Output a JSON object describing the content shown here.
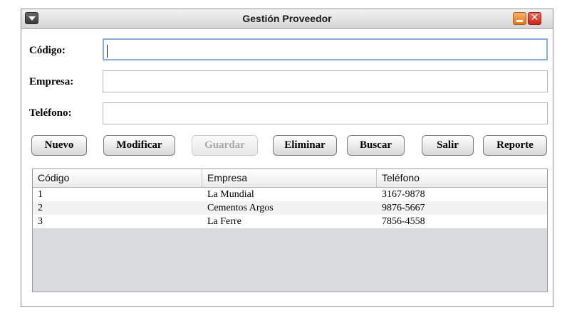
{
  "window": {
    "title": "Gestión Proveedor",
    "close_glyph": "✕"
  },
  "form": {
    "codigo_label": "Código:",
    "codigo_value": "",
    "empresa_label": "Empresa:",
    "empresa_value": "",
    "telefono_label": "Teléfono:",
    "telefono_value": ""
  },
  "buttons": {
    "nuevo": "Nuevo",
    "modificar": "Modificar",
    "guardar": "Guardar",
    "eliminar": "Eliminar",
    "buscar": "Buscar",
    "salir": "Salir",
    "reporte": "Reporte"
  },
  "table": {
    "headers": [
      "Código",
      "Empresa",
      "Teléfono"
    ],
    "rows": [
      [
        "1",
        "La Mundial",
        "3167-9878"
      ],
      [
        "2",
        "Cementos Argos",
        "9876-5667"
      ],
      [
        "3",
        "La Ferre",
        "7856-4558"
      ]
    ]
  },
  "colors": {
    "focus_border": "#8aaed6",
    "close_red": "#c9261a",
    "minimize_orange": "#e2761b",
    "table_empty_bg": "#d9dbde"
  }
}
